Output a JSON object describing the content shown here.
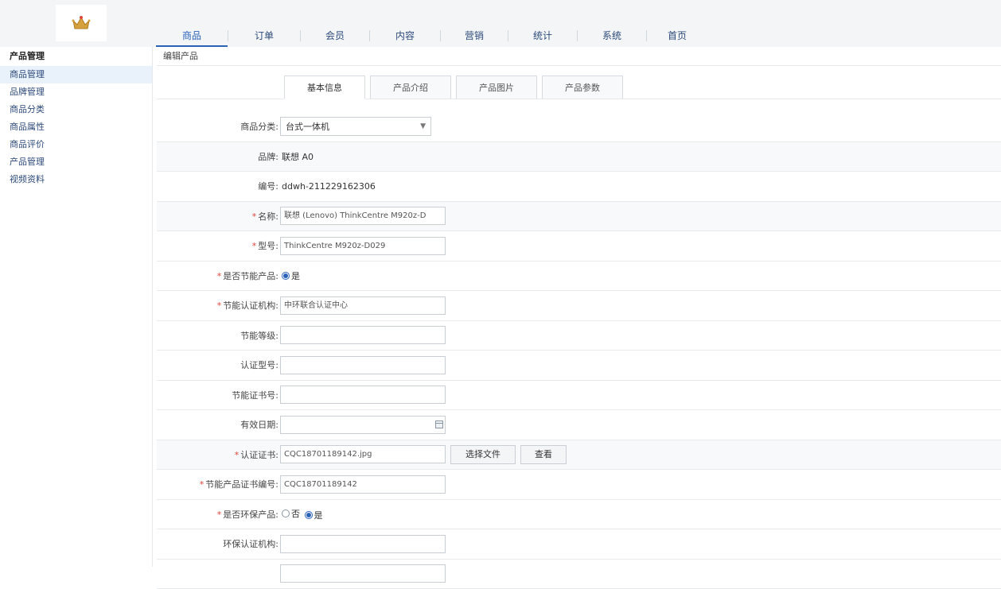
{
  "header": {
    "logo_text": "",
    "nav": [
      "商品",
      "订单",
      "会员",
      "内容",
      "营销",
      "统计",
      "系统",
      "首页"
    ],
    "active_nav": 0
  },
  "sidebar": {
    "title": "产品管理",
    "items": [
      "商品管理",
      "品牌管理",
      "商品分类",
      "商品属性",
      "商品评价",
      "产品管理",
      "视频资料"
    ],
    "active": 0
  },
  "breadcrumb": "编辑产品",
  "tabs": [
    "基本信息",
    "产品介绍",
    "产品图片",
    "产品参数"
  ],
  "form": {
    "category": {
      "label": "商品分类:",
      "value": "台式一体机"
    },
    "brand": {
      "label": "品牌:",
      "value": "联想 A0"
    },
    "code": {
      "label": "编号:",
      "value": "ddwh-211229162306"
    },
    "name": {
      "label": "名称:",
      "value": "联想 (Lenovo) ThinkCentre M920z-D"
    },
    "model": {
      "label": "型号:",
      "value": "ThinkCentre M920z-D029"
    },
    "is_energy": {
      "label": "是否节能产品:",
      "option": "是"
    },
    "cert_org": {
      "label": "节能认证机构:",
      "value": "中环联合认证中心"
    },
    "energy_level": {
      "label": "节能等级:",
      "value": ""
    },
    "cert_model": {
      "label": "认证型号:",
      "value": ""
    },
    "cert_number": {
      "label": "节能证书号:",
      "value": ""
    },
    "valid_date": {
      "label": "有效日期:",
      "value": ""
    },
    "cert_file": {
      "label": "认证证书:",
      "value": "CQC18701189142.jpg",
      "upload": "选择文件",
      "view": "查看"
    },
    "factory_cert": {
      "label": "节能产品证书编号:",
      "value": "CQC18701189142"
    },
    "is_env": {
      "label": "是否环保产品:",
      "opt_no": "否",
      "opt_yes": "是"
    },
    "env_org": {
      "label": "环保认证机构:",
      "value": ""
    },
    "env_extra": {
      "label": "",
      "value": ""
    }
  }
}
